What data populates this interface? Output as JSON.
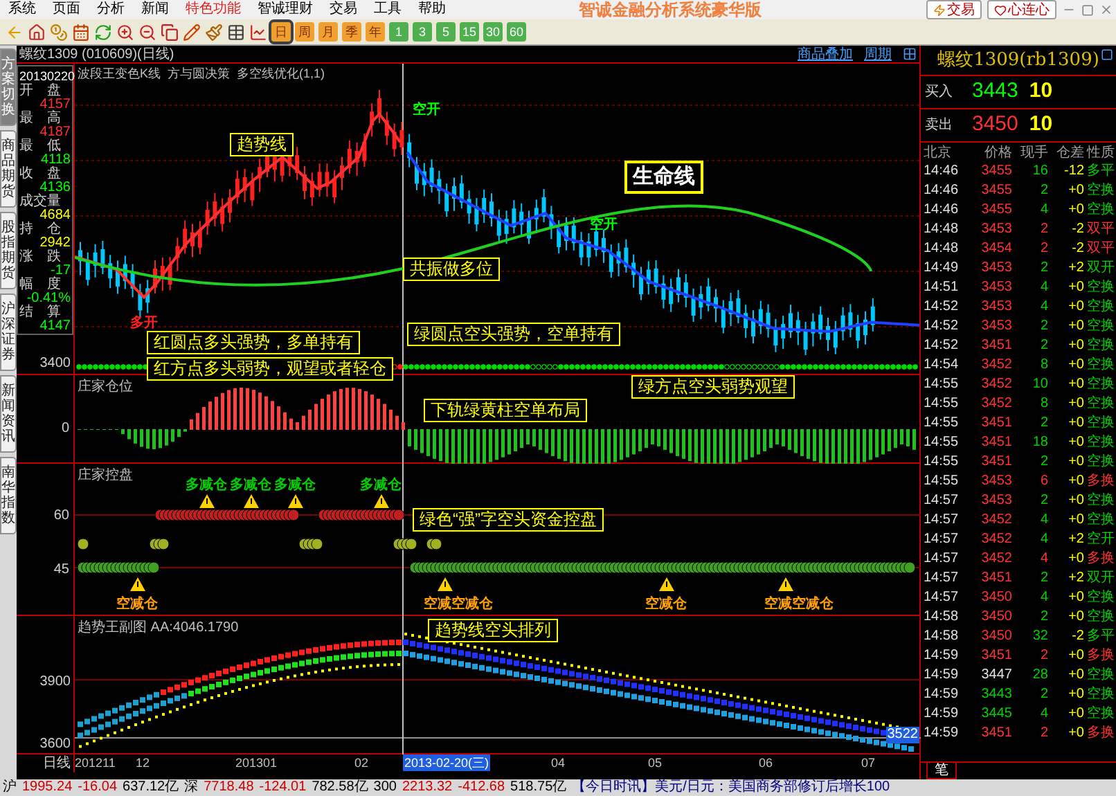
{
  "window": {
    "title": "智诚金融分析系统豪华版",
    "buttons": [
      "交易",
      "心连心"
    ]
  },
  "menu": [
    {
      "label": "系统",
      "selected": false
    },
    {
      "label": "页面",
      "selected": false
    },
    {
      "label": "分析",
      "selected": false
    },
    {
      "label": "新闻",
      "selected": false
    },
    {
      "label": "特色功能",
      "selected": true
    },
    {
      "label": "智诚理财",
      "selected": false
    },
    {
      "label": "交易",
      "selected": false
    },
    {
      "label": "工具",
      "selected": false
    },
    {
      "label": "帮助",
      "selected": false
    }
  ],
  "periods": [
    {
      "label": "日",
      "kind": "orange",
      "selected": true
    },
    {
      "label": "周",
      "kind": "orange",
      "selected": false
    },
    {
      "label": "月",
      "kind": "orange",
      "selected": false
    },
    {
      "label": "季",
      "kind": "orange",
      "selected": false
    },
    {
      "label": "年",
      "kind": "orange",
      "selected": false
    },
    {
      "label": "1",
      "kind": "green",
      "selected": false
    },
    {
      "label": "3",
      "kind": "green",
      "selected": false
    },
    {
      "label": "5",
      "kind": "green",
      "selected": false
    },
    {
      "label": "15",
      "kind": "green",
      "selected": false
    },
    {
      "label": "30",
      "kind": "green",
      "selected": false
    },
    {
      "label": "60",
      "kind": "green",
      "selected": false
    }
  ],
  "side_tabs": [
    {
      "label": "方案切换",
      "selected": true
    },
    {
      "label": "商品期货",
      "selected": false
    },
    {
      "label": "股指期货",
      "selected": false
    },
    {
      "label": "沪深证券",
      "selected": false
    },
    {
      "label": "新闻资讯",
      "selected": false
    },
    {
      "label": "南华指数",
      "selected": false
    }
  ],
  "chart_header": {
    "title": "螺纹1309 (010609)(日线)",
    "links": [
      "商品叠加",
      "周期"
    ]
  },
  "info": {
    "date": "20130220",
    "items": [
      {
        "label": "开　盘",
        "value": "4157",
        "color": "#ff3030"
      },
      {
        "label": "最　高",
        "value": "4187",
        "color": "#ff3030"
      },
      {
        "label": "最　低",
        "value": "4118",
        "color": "#00ff00"
      },
      {
        "label": "收　盘",
        "value": "4136",
        "color": "#00ff00"
      },
      {
        "label": "成交量",
        "value": "4684",
        "color": "#ffff00"
      },
      {
        "label": "持　仓",
        "value": "2942",
        "color": "#ffff00"
      },
      {
        "label": "涨　跌",
        "value": "-17",
        "color": "#00ff00"
      },
      {
        "label": "幅　度",
        "value": "-0.41%",
        "color": "#00ff00"
      },
      {
        "label": "结　算",
        "value": "4147",
        "color": "#00ff00"
      }
    ]
  },
  "main_pane": {
    "legend": "波段王变色K线  方与圆决策  多空线优化(1,1)",
    "y_label": "3400",
    "signals": [
      {
        "text": "多开",
        "color": "#ff2020"
      },
      {
        "text": "空开",
        "color": "#00ff00"
      },
      {
        "text": "空开",
        "color": "#00ff00"
      }
    ],
    "notes": [
      {
        "text": "趋势线",
        "kind": "box"
      },
      {
        "text": "生命线",
        "kind": "big"
      },
      {
        "text": "共振做多位",
        "kind": "box"
      },
      {
        "text": "红圆点多头强势，多单持有",
        "kind": "box"
      },
      {
        "text": "绿圆点空头强势，空单持有",
        "kind": "box"
      },
      {
        "text": "红方点多头弱势，观望或者轻仓",
        "kind": "box"
      },
      {
        "text": "绿方点空头弱势观望",
        "kind": "box"
      }
    ]
  },
  "position_pane": {
    "title": "庄家仓位",
    "y_label": "0",
    "notes": [
      {
        "text": "下轨绿黄柱空单布局",
        "kind": "box"
      }
    ]
  },
  "control_pane": {
    "title": "庄家控盘",
    "y_labels": [
      "60",
      "45"
    ],
    "signals": [
      {
        "text": "多减仓",
        "color": "#00d000"
      },
      {
        "text": "多减仓",
        "color": "#00d000"
      },
      {
        "text": "多减仓",
        "color": "#00d000"
      },
      {
        "text": "多减仓",
        "color": "#00d000"
      },
      {
        "text": "空减仓",
        "color": "#ffa000"
      },
      {
        "text": "空减空减仓",
        "color": "#ffa000"
      },
      {
        "text": "空减仓",
        "color": "#ffa000"
      },
      {
        "text": "空减空减仓",
        "color": "#ffa000"
      }
    ],
    "notes": [
      {
        "text": "绿色“强”字空头资金控盘",
        "kind": "box"
      }
    ]
  },
  "trend_pane": {
    "title": "趋势王副图 AA:4046.1790",
    "y_labels": [
      "3900",
      "3600"
    ],
    "price_tag": "3522",
    "notes": [
      {
        "text": "趋势线空头排列",
        "kind": "box"
      }
    ]
  },
  "x_axis": {
    "label": "日线",
    "ticks": [
      {
        "text": "201211",
        "selected": false
      },
      {
        "text": "12",
        "selected": false
      },
      {
        "text": "201301",
        "selected": false
      },
      {
        "text": "02",
        "selected": false
      },
      {
        "text": "2013-02-20(三)",
        "selected": true
      },
      {
        "text": "04",
        "selected": false
      },
      {
        "text": "05",
        "selected": false
      },
      {
        "text": "06",
        "selected": false
      },
      {
        "text": "07",
        "selected": false
      }
    ]
  },
  "quote": {
    "title": "螺纹1309(rb1309)",
    "bid": {
      "label": "买入",
      "price": "3443",
      "volume": "10"
    },
    "ask": {
      "label": "卖出",
      "price": "3450",
      "volume": "10"
    },
    "columns": [
      "北京",
      "价格",
      "现手",
      "仓差",
      "性质"
    ],
    "rows": [
      {
        "time": "14:46",
        "price": {
          "text": "3455",
          "color": "#ff3030"
        },
        "volume": "16",
        "change": "-12",
        "nature": {
          "text": "多平",
          "color": "#00d000"
        }
      },
      {
        "time": "14:46",
        "price": {
          "text": "3455",
          "color": "#ff3030"
        },
        "volume": "2",
        "change": "+0",
        "nature": {
          "text": "空换",
          "color": "#00d000"
        }
      },
      {
        "time": "14:46",
        "price": {
          "text": "3455",
          "color": "#ff3030"
        },
        "volume": "4",
        "change": "+0",
        "nature": {
          "text": "空换",
          "color": "#00d000"
        }
      },
      {
        "time": "14:48",
        "price": {
          "text": "3453",
          "color": "#ff3030"
        },
        "volume": "2",
        "change": "-2",
        "nature": {
          "text": "双平",
          "color": "#ff3030"
        }
      },
      {
        "time": "14:48",
        "price": {
          "text": "3454",
          "color": "#ff3030"
        },
        "volume": "2",
        "change": "-2",
        "nature": {
          "text": "双平",
          "color": "#ff3030"
        }
      },
      {
        "time": "14:49",
        "price": {
          "text": "3453",
          "color": "#ff3030"
        },
        "volume": "2",
        "change": "+2",
        "nature": {
          "text": "双开",
          "color": "#00d000"
        }
      },
      {
        "time": "14:51",
        "price": {
          "text": "3453",
          "color": "#ff3030"
        },
        "volume": "4",
        "change": "+0",
        "nature": {
          "text": "空换",
          "color": "#00d000"
        }
      },
      {
        "time": "14:52",
        "price": {
          "text": "3453",
          "color": "#ff3030"
        },
        "volume": "4",
        "change": "+0",
        "nature": {
          "text": "空换",
          "color": "#00d000"
        }
      },
      {
        "time": "14:52",
        "price": {
          "text": "3453",
          "color": "#ff3030"
        },
        "volume": "2",
        "change": "+0",
        "nature": {
          "text": "空换",
          "color": "#00d000"
        }
      },
      {
        "time": "14:52",
        "price": {
          "text": "3451",
          "color": "#ff3030"
        },
        "volume": "2",
        "change": "+0",
        "nature": {
          "text": "空换",
          "color": "#00d000"
        }
      },
      {
        "time": "14:54",
        "price": {
          "text": "3452",
          "color": "#ff3030"
        },
        "volume": "8",
        "change": "+0",
        "nature": {
          "text": "空换",
          "color": "#00d000"
        }
      },
      {
        "time": "14:55",
        "price": {
          "text": "3452",
          "color": "#ff3030"
        },
        "volume": "10",
        "change": "+0",
        "nature": {
          "text": "空换",
          "color": "#00d000"
        }
      },
      {
        "time": "14:55",
        "price": {
          "text": "3452",
          "color": "#ff3030"
        },
        "volume": "8",
        "change": "+0",
        "nature": {
          "text": "空换",
          "color": "#00d000"
        }
      },
      {
        "time": "14:55",
        "price": {
          "text": "3451",
          "color": "#ff3030"
        },
        "volume": "2",
        "change": "+0",
        "nature": {
          "text": "空换",
          "color": "#00d000"
        }
      },
      {
        "time": "14:55",
        "price": {
          "text": "3451",
          "color": "#ff3030"
        },
        "volume": "18",
        "change": "+0",
        "nature": {
          "text": "空换",
          "color": "#00d000"
        }
      },
      {
        "time": "14:55",
        "price": {
          "text": "3451",
          "color": "#ff3030"
        },
        "volume": "2",
        "change": "+0",
        "nature": {
          "text": "空换",
          "color": "#00d000"
        }
      },
      {
        "time": "14:55",
        "price": {
          "text": "3453",
          "color": "#ff3030"
        },
        "volume": "6",
        "change": "+0",
        "nature": {
          "text": "多换",
          "color": "#ff3030"
        }
      },
      {
        "time": "14:57",
        "price": {
          "text": "3453",
          "color": "#ff3030"
        },
        "volume": "2",
        "change": "+0",
        "nature": {
          "text": "空换",
          "color": "#00d000"
        }
      },
      {
        "time": "14:57",
        "price": {
          "text": "3452",
          "color": "#ff3030"
        },
        "volume": "4",
        "change": "+0",
        "nature": {
          "text": "空换",
          "color": "#00d000"
        }
      },
      {
        "time": "14:57",
        "price": {
          "text": "3452",
          "color": "#ff3030"
        },
        "volume": "4",
        "change": "+2",
        "nature": {
          "text": "空开",
          "color": "#00d000"
        }
      },
      {
        "time": "14:57",
        "price": {
          "text": "3452",
          "color": "#ff3030"
        },
        "volume": "4",
        "change": "+0",
        "nature": {
          "text": "多换",
          "color": "#ff3030"
        }
      },
      {
        "time": "14:57",
        "price": {
          "text": "3451",
          "color": "#ff3030"
        },
        "volume": "2",
        "change": "+2",
        "nature": {
          "text": "双开",
          "color": "#00d000"
        }
      },
      {
        "time": "14:57",
        "price": {
          "text": "3450",
          "color": "#ff3030"
        },
        "volume": "4",
        "change": "+0",
        "nature": {
          "text": "空换",
          "color": "#00d000"
        }
      },
      {
        "time": "14:58",
        "price": {
          "text": "3450",
          "color": "#ff3030"
        },
        "volume": "2",
        "change": "+0",
        "nature": {
          "text": "空换",
          "color": "#00d000"
        }
      },
      {
        "time": "14:58",
        "price": {
          "text": "3450",
          "color": "#ff3030"
        },
        "volume": "32",
        "change": "-2",
        "nature": {
          "text": "多平",
          "color": "#00d000"
        }
      },
      {
        "time": "14:59",
        "price": {
          "text": "3451",
          "color": "#ff3030"
        },
        "volume": "2",
        "change": "+0",
        "nature": {
          "text": "多换",
          "color": "#ff3030"
        }
      },
      {
        "time": "14:59",
        "price": {
          "text": "3447",
          "color": "#e0e0e0"
        },
        "volume": "28",
        "change": "+0",
        "nature": {
          "text": "空换",
          "color": "#00d000"
        }
      },
      {
        "time": "14:59",
        "price": {
          "text": "3443",
          "color": "#00d000"
        },
        "volume": "2",
        "change": "+0",
        "nature": {
          "text": "空换",
          "color": "#00d000"
        }
      },
      {
        "time": "14:59",
        "price": {
          "text": "3445",
          "color": "#00d000"
        },
        "volume": "4",
        "change": "+0",
        "nature": {
          "text": "空换",
          "color": "#00d000"
        }
      },
      {
        "time": "14:59",
        "price": {
          "text": "3451",
          "color": "#ff3030"
        },
        "volume": "2",
        "change": "+0",
        "nature": {
          "text": "多换",
          "color": "#ff3030"
        }
      }
    ],
    "tab": "笔"
  },
  "status_bar": [
    {
      "text": "沪",
      "color": "#000000"
    },
    {
      "text": "1995.24",
      "color": "#d00000"
    },
    {
      "text": "-16.04",
      "color": "#d00000"
    },
    {
      "text": "637.12亿",
      "color": "#000000"
    },
    {
      "text": "深",
      "color": "#000000"
    },
    {
      "text": "7718.48",
      "color": "#d00000"
    },
    {
      "text": "-124.01",
      "color": "#d00000"
    },
    {
      "text": "782.58亿",
      "color": "#000000"
    },
    {
      "text": "300",
      "color": "#000000"
    },
    {
      "text": "2213.32",
      "color": "#d00000"
    },
    {
      "text": "-412.68",
      "color": "#d00000"
    },
    {
      "text": "518.75亿",
      "color": "#000000"
    },
    {
      "text": "【今日时讯】美元/日元：美国商务部修订后增长100",
      "color": "#000080"
    }
  ]
}
